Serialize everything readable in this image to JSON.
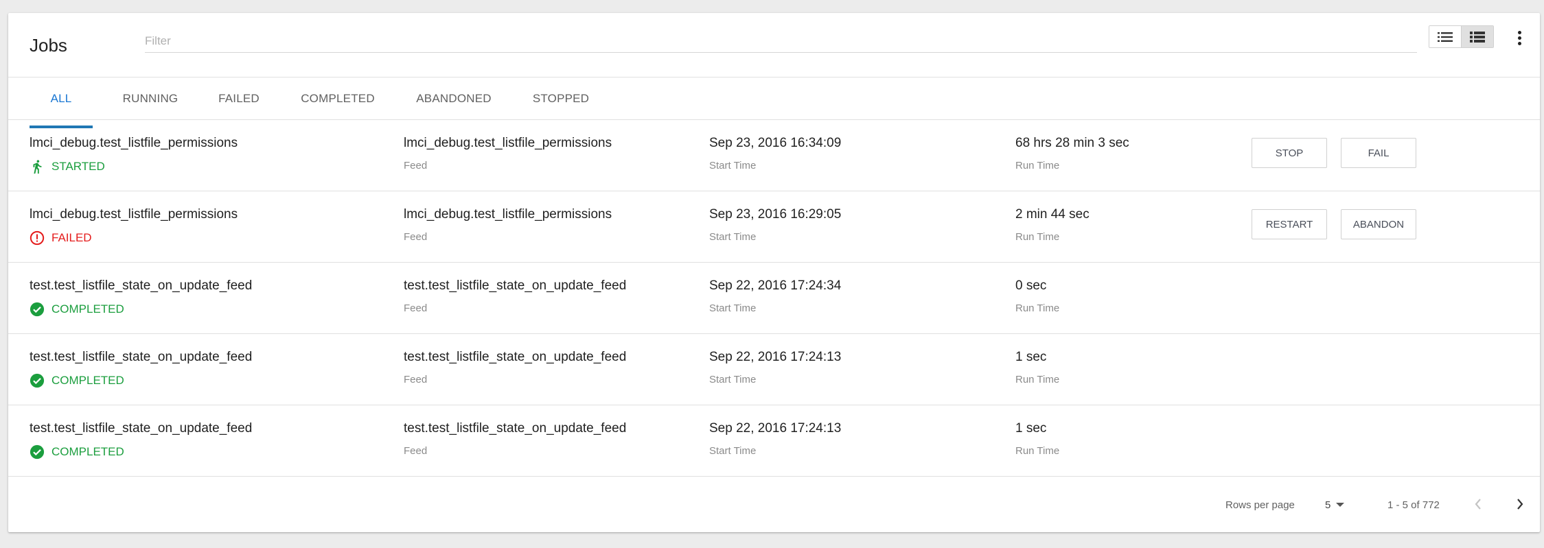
{
  "header": {
    "title": "Jobs",
    "filter_placeholder": "Filter",
    "filter_value": "",
    "view_modes": [
      {
        "icon": "list-view-icon",
        "active": false
      },
      {
        "icon": "table-view-icon",
        "active": true
      }
    ],
    "menu_icon": "more-vert-icon"
  },
  "tabs": [
    {
      "label": "ALL",
      "active": true
    },
    {
      "label": "RUNNING",
      "active": false
    },
    {
      "label": "FAILED",
      "active": false
    },
    {
      "label": "COMPLETED",
      "active": false
    },
    {
      "label": "ABANDONED",
      "active": false
    },
    {
      "label": "STOPPED",
      "active": false
    }
  ],
  "columns": {
    "feed_label": "Feed",
    "start_label": "Start Time",
    "run_label": "Run Time"
  },
  "rows": [
    {
      "name": "lmci_debug.test_listfile_permissions",
      "status": "STARTED",
      "status_icon": "running-icon",
      "feed": "lmci_debug.test_listfile_permissions",
      "start_time": "Sep 23, 2016 16:34:09",
      "run_time": "68 hrs 28 min 3 sec",
      "actions": [
        "STOP",
        "FAIL"
      ]
    },
    {
      "name": "lmci_debug.test_listfile_permissions",
      "status": "FAILED",
      "status_icon": "error-icon",
      "feed": "lmci_debug.test_listfile_permissions",
      "start_time": "Sep 23, 2016 16:29:05",
      "run_time": "2 min 44 sec",
      "actions": [
        "RESTART",
        "ABANDON"
      ]
    },
    {
      "name": "test.test_listfile_state_on_update_feed",
      "status": "COMPLETED",
      "status_icon": "check-circle-icon",
      "feed": "test.test_listfile_state_on_update_feed",
      "start_time": "Sep 22, 2016 17:24:34",
      "run_time": "0 sec",
      "actions": []
    },
    {
      "name": "test.test_listfile_state_on_update_feed",
      "status": "COMPLETED",
      "status_icon": "check-circle-icon",
      "feed": "test.test_listfile_state_on_update_feed",
      "start_time": "Sep 22, 2016 17:24:13",
      "run_time": "1 sec",
      "actions": []
    },
    {
      "name": "test.test_listfile_state_on_update_feed",
      "status": "COMPLETED",
      "status_icon": "check-circle-icon",
      "feed": "test.test_listfile_state_on_update_feed",
      "start_time": "Sep 22, 2016 17:24:13",
      "run_time": "1 sec",
      "actions": []
    }
  ],
  "pagination": {
    "rows_per_page_label": "Rows per page",
    "rows_per_page": "5",
    "range": "1 - 5 of 772",
    "prev_icon": "chevron-left-icon",
    "next_icon": "chevron-right-icon"
  },
  "colors": {
    "accent": "#1976d2",
    "success": "#1b9e3e",
    "error": "#e41c1c"
  }
}
